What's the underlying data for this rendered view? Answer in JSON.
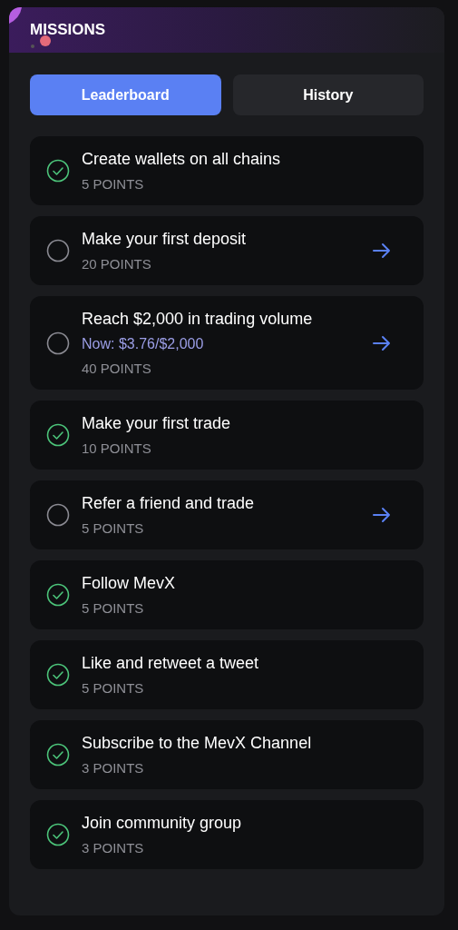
{
  "header": {
    "title": "MISSIONS"
  },
  "tabs": [
    {
      "label": "Leaderboard",
      "selected": true
    },
    {
      "label": "History",
      "selected": false
    }
  ],
  "missions": [
    {
      "title": "Create wallets on all chains",
      "points": "5 POINTS",
      "done": true
    },
    {
      "title": "Make your first deposit",
      "points": "20 POINTS",
      "done": false
    },
    {
      "title": "Reach $2,000 in trading volume",
      "progress": "Now: $3.76/$2,000",
      "points": "40 POINTS",
      "done": false
    },
    {
      "title": "Make your first trade",
      "points": "10 POINTS",
      "done": true
    },
    {
      "title": "Refer a friend and trade",
      "points": "5 POINTS",
      "done": false
    },
    {
      "title": "Follow MevX",
      "points": "5 POINTS",
      "done": true
    },
    {
      "title": "Like and retweet a tweet",
      "points": "5 POINTS",
      "done": true
    },
    {
      "title": "Subscribe to the MevX Channel",
      "points": "3 POINTS",
      "done": true
    },
    {
      "title": "Join community group",
      "points": "3 POINTS",
      "done": true
    }
  ]
}
